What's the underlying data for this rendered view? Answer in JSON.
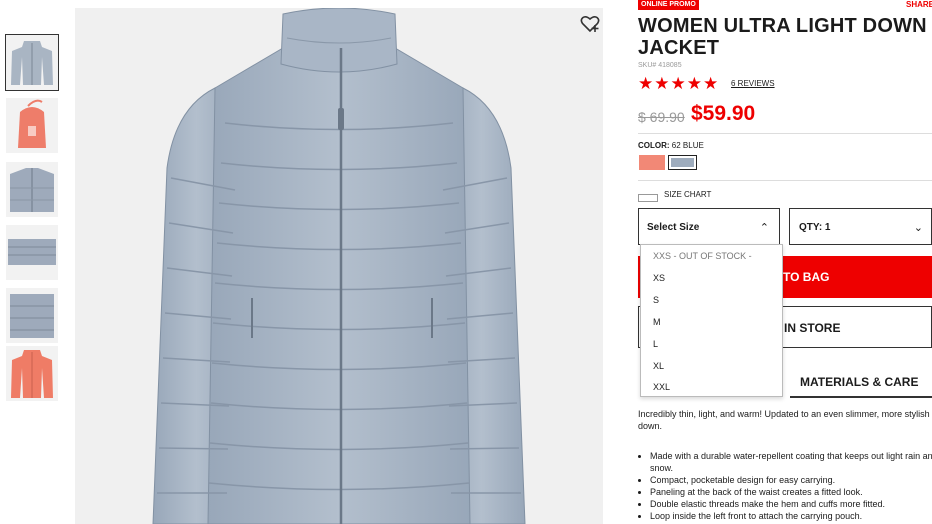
{
  "thumbnails": [
    {
      "alt": "gray jacket front"
    },
    {
      "alt": "coral pouch"
    },
    {
      "alt": "collar detail"
    },
    {
      "alt": "cuff detail"
    },
    {
      "alt": "folded jacket"
    },
    {
      "alt": "coral jacket"
    }
  ],
  "product": {
    "promo_badge": "ONLINE PROMO",
    "share_label": "SHARE",
    "title": "WOMEN ULTRA LIGHT DOWN JACKET",
    "sku": "SKU# 418085",
    "stars": "★★★★★",
    "reviews_label": "6 REVIEWS",
    "old_price": "$ 69.90",
    "new_price": "$59.90",
    "color_label": "COLOR:",
    "color_value": "62 BLUE",
    "size_chart_label": "SIZE CHART",
    "size_select_label": "Select Size",
    "qty_label": "QTY: 1",
    "add_to_bag_label": "TO BAG",
    "find_in_store_label": "IN STORE",
    "materials_tab_label": "MATERIALS & CARE",
    "description": "Incredibly thin, light, and warm! Updated to an even slimmer, more stylish down.",
    "bullets": [
      "Made with a durable water-repellent coating that keeps out light rain and snow.",
      "Compact, pocketable design for easy carrying.",
      "Paneling at the back of the waist creates a fitted look.",
      "Double elastic threads make the hem and cuffs more fitted.",
      "Loop inside the left front to attach the carrying pouch."
    ]
  },
  "size_dropdown": {
    "options": [
      "XXS - OUT OF STOCK -",
      "XS",
      "S",
      "M",
      "L",
      "XL",
      "XXL"
    ]
  },
  "colors": {
    "accent": "#e00000",
    "swatch_coral": "#f28876",
    "swatch_blue": "#9eacbd"
  },
  "icons": {
    "wishlist": "heart-plus-icon",
    "size_chart": "ruler-icon",
    "chevron": "chevron-icon"
  }
}
